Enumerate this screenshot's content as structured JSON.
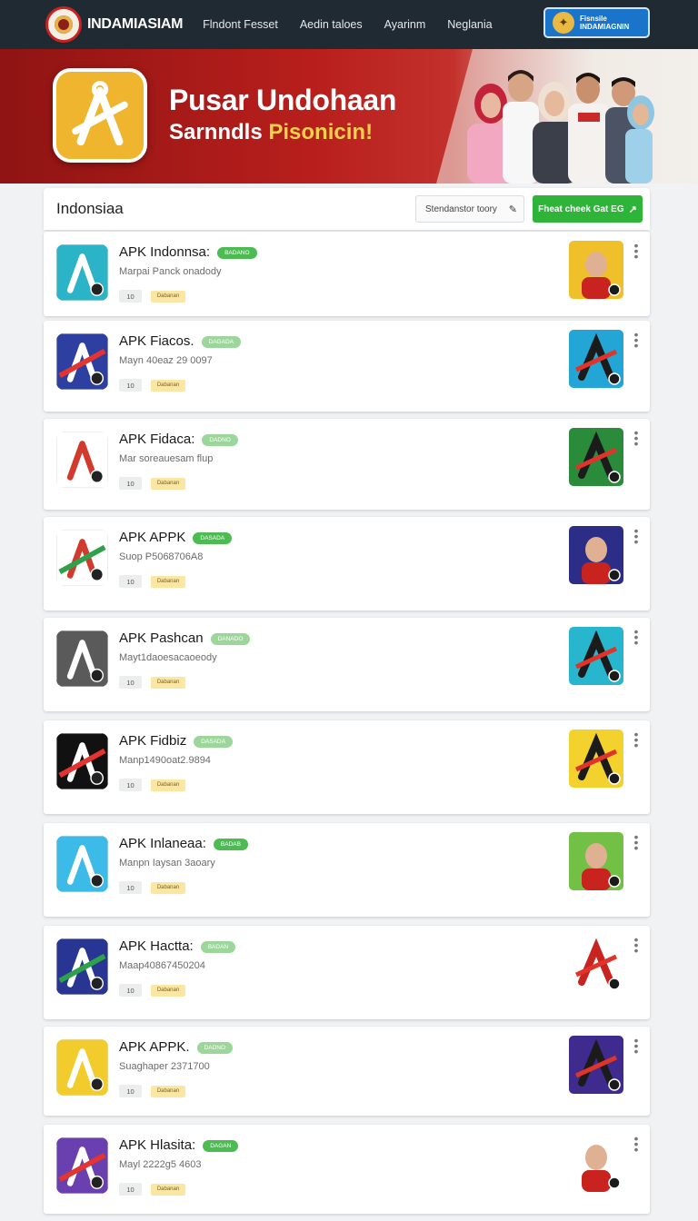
{
  "nav": {
    "brand": "INDAMIASIAM",
    "links": [
      "Flndont Fesset",
      "Aedin taloes",
      "Ayarinm",
      "Neglania"
    ],
    "cta": {
      "line1": "Fisnsile",
      "line2": "INDAMIAGNIN"
    }
  },
  "hero": {
    "title": "Pusar Undohaan",
    "subtitle": "Sarnndls",
    "subtitle_highlight": "Pisonicin!"
  },
  "search": {
    "title": "Indonsiaa",
    "placeholder": "Stendanstor toory",
    "button": "Fheat cheek Gat EG"
  },
  "apps": [
    {
      "name": "APK Indonnsa:",
      "badge": "BADANO",
      "desc": "Marpai Panck onadody",
      "rating": "10",
      "tag": "Dabanan",
      "icon_color": "#2bb3c8",
      "thumb_color": "#f0c02a"
    },
    {
      "name": "APK Fiacos.",
      "badge": "DAGADA",
      "desc": "Mayn 40eaz 29 0097",
      "rating": "10",
      "tag": "Dabanan",
      "icon_color": "#2d3fa0",
      "thumb_color": "#23a6d5"
    },
    {
      "name": "APK Fidaca:",
      "badge": "DADNO",
      "desc": "Mar soreauesam flup",
      "rating": "10",
      "tag": "Dabanan",
      "icon_color": "#ffffff",
      "thumb_color": "#2a8b3b"
    },
    {
      "name": "APK APPK",
      "badge": "DASADA",
      "desc": "Suop P5068706A8",
      "rating": "10",
      "tag": "Dabanan",
      "icon_color": "#ffffff",
      "thumb_color": "#2c2d86"
    },
    {
      "name": "APK Pashcan",
      "badge": "DANADO",
      "desc": "Mayt1daoesacaoeody",
      "rating": "10",
      "tag": "Dabanan",
      "icon_color": "#5a5a5a",
      "thumb_color": "#28b6cf"
    },
    {
      "name": "APK Fidbiz",
      "badge": "DASADA",
      "desc": "Manp1490oat2.9894",
      "rating": "10",
      "tag": "Dabanan",
      "icon_color": "#111111",
      "thumb_color": "#f3d22e"
    },
    {
      "name": "APK Inlaneaa:",
      "badge": "BADAB",
      "desc": "Manpn Iaysan 3aoary",
      "rating": "10",
      "tag": "Dabanan",
      "icon_color": "#3dbbe8",
      "thumb_color": "#72c045"
    },
    {
      "name": "APK Hactta:",
      "badge": "BADAN",
      "desc": "Maap40867450204",
      "rating": "10",
      "tag": "Dabanan",
      "icon_color": "#283593",
      "thumb_color": "#ffffff"
    },
    {
      "name": "APK APPK.",
      "badge": "DADNO",
      "desc": "Suaghaper 2371700",
      "rating": "10",
      "tag": "Dabanan",
      "icon_color": "#f2cc2d",
      "thumb_color": "#3f2b8e"
    },
    {
      "name": "APK Hlasita:",
      "badge": "DAGAN",
      "desc": "Mayl 2222g5 4603",
      "rating": "10",
      "tag": "Dabanan",
      "icon_color": "#6a3fb0",
      "thumb_color": "#ffffff"
    }
  ]
}
